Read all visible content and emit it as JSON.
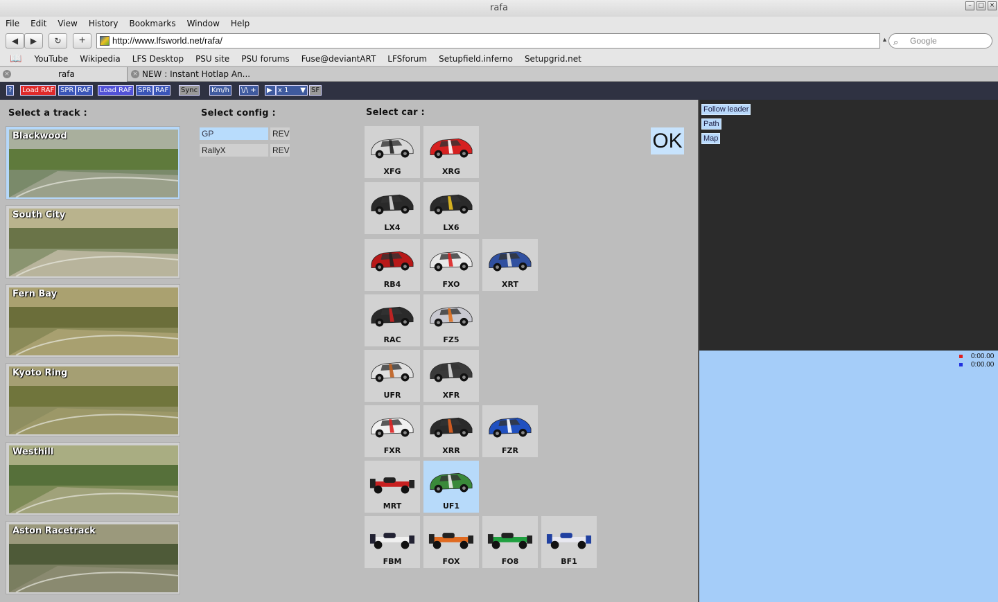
{
  "window": {
    "title": "rafa"
  },
  "menu": [
    "File",
    "Edit",
    "View",
    "History",
    "Bookmarks",
    "Window",
    "Help"
  ],
  "nav": {
    "back": "◀",
    "forward": "▶",
    "reload": "↻",
    "add": "+",
    "url": "http://www.lfsworld.net/rafa/",
    "search_placeholder": "Google"
  },
  "bookmarks": [
    "YouTube",
    "Wikipedia",
    "LFS Desktop",
    "PSU site",
    "PSU forums",
    "Fuse@deviantART",
    "LFSforum",
    "Setupfield.inferno",
    "Setupgrid.net"
  ],
  "tabs": [
    {
      "label": "rafa"
    },
    {
      "label": "NEW : Instant Hotlap An..."
    }
  ],
  "toolbar": {
    "help": "?",
    "load_raf_1": "Load RAF",
    "spr_1": "SPR",
    "raf_1": "RAF",
    "load_raf_2": "Load RAF",
    "spr_2": "SPR",
    "raf_2": "RAF",
    "sync": "Sync",
    "kmh": "Km/h",
    "v_plus": "\\/\\ +",
    "speed": "x 1",
    "sf": "SF"
  },
  "headings": {
    "track": "Select a track :",
    "config": "Select config :",
    "car": "Select car :"
  },
  "tracks": [
    {
      "name": "Blackwood",
      "selected": true
    },
    {
      "name": "South City",
      "selected": false
    },
    {
      "name": "Fern Bay",
      "selected": false
    },
    {
      "name": "Kyoto Ring",
      "selected": false
    },
    {
      "name": "Westhill",
      "selected": false
    },
    {
      "name": "Aston Racetrack",
      "selected": false
    }
  ],
  "configs": [
    {
      "name": "GP",
      "rev": "REV",
      "selected": true
    },
    {
      "name": "RallyX",
      "rev": "REV",
      "selected": false
    }
  ],
  "cars": [
    {
      "name": "XFG",
      "color": "#d8d8d8",
      "accent": "#222"
    },
    {
      "name": "XRG",
      "color": "#d62020",
      "accent": "#fff"
    },
    {
      "name": "LX4",
      "color": "#2a2a2a",
      "accent": "#ddd"
    },
    {
      "name": "LX6",
      "color": "#2a2a2a",
      "accent": "#e8c020"
    },
    {
      "name": "RB4",
      "color": "#b81818",
      "accent": "#222"
    },
    {
      "name": "FXO",
      "color": "#e8e8e8",
      "accent": "#d22"
    },
    {
      "name": "XRT",
      "color": "#3050a0",
      "accent": "#ddd"
    },
    {
      "name": "RAC",
      "color": "#2a2a2a",
      "accent": "#c22"
    },
    {
      "name": "FZ5",
      "color": "#c8c8d0",
      "accent": "#e07020"
    },
    {
      "name": "UFR",
      "color": "#e0e0e0",
      "accent": "#c06020"
    },
    {
      "name": "XFR",
      "color": "#3a3a3a",
      "accent": "#ddd"
    },
    {
      "name": "FXR",
      "color": "#f0f0f0",
      "accent": "#d22"
    },
    {
      "name": "XRR",
      "color": "#2a2a2a",
      "accent": "#e06020"
    },
    {
      "name": "FZR",
      "color": "#2050c0",
      "accent": "#fff"
    },
    {
      "name": "MRT",
      "color": "#c82020",
      "accent": "#222"
    },
    {
      "name": "UF1",
      "color": "#3a8a3a",
      "accent": "#eee"
    },
    {
      "name": "FBM",
      "color": "#f0f0f0",
      "accent": "#223"
    },
    {
      "name": "FOX",
      "color": "#e06a20",
      "accent": "#222"
    },
    {
      "name": "FO8",
      "color": "#20a040",
      "accent": "#222"
    },
    {
      "name": "BF1",
      "color": "#e8e8f0",
      "accent": "#2040a0"
    }
  ],
  "selected_car": "UF1",
  "ok": "OK",
  "right_panel": {
    "follow_leader": "Follow leader",
    "path": "Path",
    "map": "Map",
    "times": [
      {
        "value": "0:00.00",
        "color": "#e02020"
      },
      {
        "value": "0:00.00",
        "color": "#2030e0"
      }
    ]
  }
}
